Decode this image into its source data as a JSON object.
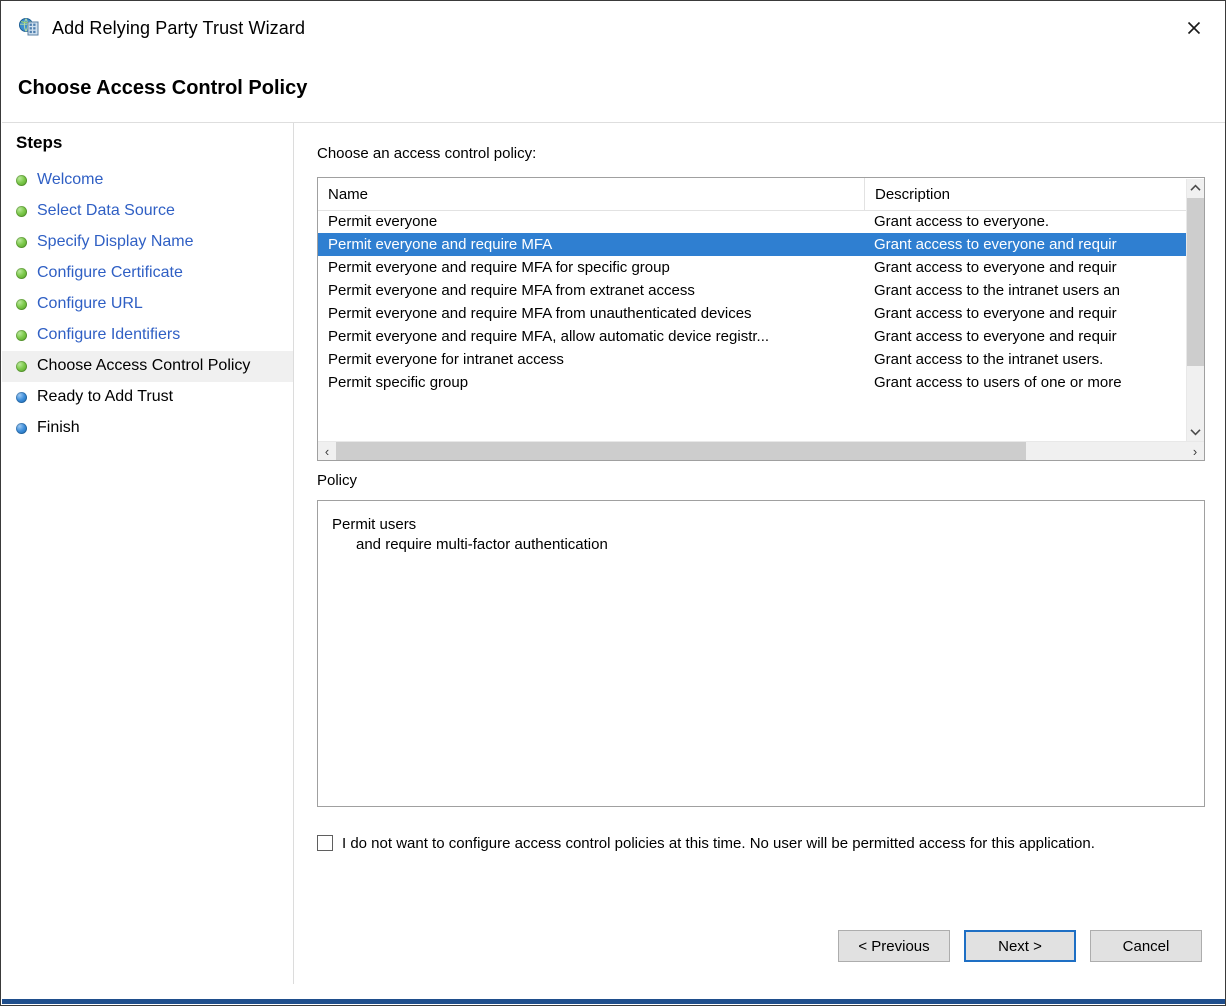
{
  "window": {
    "title": "Add Relying Party Trust Wizard",
    "icon": "adfs-relying-party-icon",
    "close_icon": "close-icon",
    "header_title": "Choose Access Control Policy",
    "accent_color": "#1f4e8c"
  },
  "sidebar": {
    "heading": "Steps",
    "items": [
      {
        "label": "Welcome",
        "state": "done"
      },
      {
        "label": "Select Data Source",
        "state": "done"
      },
      {
        "label": "Specify Display Name",
        "state": "done"
      },
      {
        "label": "Configure Certificate",
        "state": "done"
      },
      {
        "label": "Configure URL",
        "state": "done"
      },
      {
        "label": "Configure Identifiers",
        "state": "done"
      },
      {
        "label": "Choose Access Control Policy",
        "state": "current"
      },
      {
        "label": "Ready to Add Trust",
        "state": "future"
      },
      {
        "label": "Finish",
        "state": "future"
      }
    ]
  },
  "main": {
    "choose_label": "Choose an access control policy:",
    "columns": [
      "Name",
      "Description"
    ],
    "rows": [
      {
        "name": "Permit everyone",
        "description": "Grant access to everyone.",
        "selected": false
      },
      {
        "name": "Permit everyone and require MFA",
        "description": "Grant access to everyone and requir",
        "selected": true
      },
      {
        "name": "Permit everyone and require MFA for specific group",
        "description": "Grant access to everyone and requir",
        "selected": false
      },
      {
        "name": "Permit everyone and require MFA from extranet access",
        "description": "Grant access to the intranet users an",
        "selected": false
      },
      {
        "name": "Permit everyone and require MFA from unauthenticated devices",
        "description": "Grant access to everyone and requir",
        "selected": false
      },
      {
        "name": "Permit everyone and require MFA, allow automatic device registr...",
        "description": "Grant access to everyone and requir",
        "selected": false
      },
      {
        "name": "Permit everyone for intranet access",
        "description": "Grant access to the intranet users.",
        "selected": false
      },
      {
        "name": "Permit specific group",
        "description": "Grant access to users of one or more",
        "selected": false
      }
    ],
    "policy_label": "Policy",
    "policy_lines": [
      "Permit users",
      "and require multi-factor authentication"
    ],
    "checkbox": {
      "checked": false,
      "label": "I do not want to configure access control policies at this time. No user will be permitted access for this application."
    }
  },
  "footer": {
    "previous_label": "< Previous",
    "next_label": "Next >",
    "cancel_label": "Cancel"
  },
  "scrollbars": {
    "up_arrow": "˄",
    "down_arrow": "˅",
    "left_arrow": "‹",
    "right_arrow": "›"
  }
}
